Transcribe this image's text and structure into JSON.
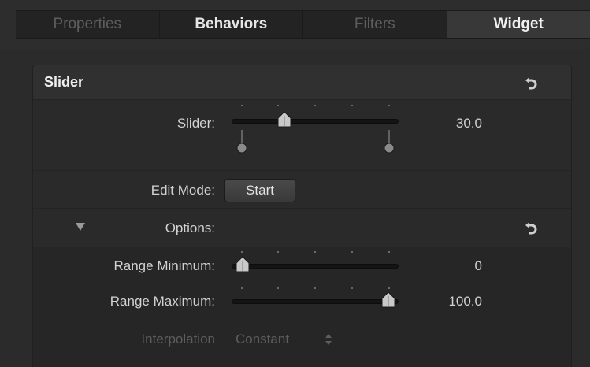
{
  "tabs": [
    {
      "label": "Properties"
    },
    {
      "label": "Behaviors"
    },
    {
      "label": "Filters"
    },
    {
      "label": "Widget"
    }
  ],
  "active_tab": "Widget",
  "panel": {
    "title": "Slider",
    "slider": {
      "label": "Slider:",
      "value": "30.0"
    },
    "edit_mode": {
      "label": "Edit Mode:",
      "button": "Start"
    },
    "options": {
      "label": "Options:"
    },
    "range_min": {
      "label": "Range Minimum:",
      "value": "0"
    },
    "range_max": {
      "label": "Range Maximum:",
      "value": "100.0"
    },
    "interpolation": {
      "label": "Interpolation",
      "value": "Constant"
    }
  },
  "icons": {
    "reset": "reset-arrow-icon",
    "disclosure": "disclosure-triangle-icon",
    "stepper": "up-down-stepper-icon"
  },
  "colors": {
    "background": "#2b2b2b",
    "panel": "#2a2a2a",
    "text": "#d2d2d2",
    "dim_text": "#5d5d5d"
  }
}
